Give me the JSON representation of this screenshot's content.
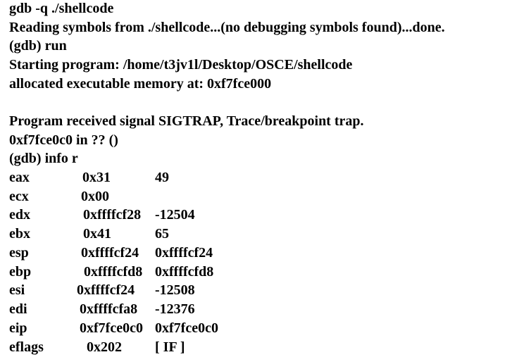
{
  "lines": [
    "gdb -q ./shellcode",
    "Reading symbols from ./shellcode...(no debugging symbols found)...done.",
    "(gdb) run",
    "Starting program: /home/t3jv1l/Desktop/OSCE/shellcode",
    "allocated executable memory at: 0xf7fce000",
    "",
    "Program received signal SIGTRAP, Trace/breakpoint trap.",
    "0xf7fce0c0 in ?? ()",
    "(gdb) info r"
  ],
  "registers": [
    {
      "name": "eax",
      "hex": "0x31",
      "value": "49"
    },
    {
      "name": "ecx",
      "hex": "0x00",
      "value": ""
    },
    {
      "name": "edx",
      "hex": "0xffffcf28",
      "value": "-12504"
    },
    {
      "name": "ebx",
      "hex": "0x41",
      "value": "65"
    },
    {
      "name": "esp",
      "hex": "0xffffcf24",
      "value": "0xffffcf24"
    },
    {
      "name": "ebp",
      "hex": "0xffffcfd8",
      "value": "0xffffcfd8"
    },
    {
      "name": "esi",
      "hex": "0xffffcf24",
      "value": "-12508"
    },
    {
      "name": "edi",
      "hex": "0xffffcfa8",
      "value": "-12376"
    },
    {
      "name": "eip",
      "hex": "0xf7fce0c0",
      "value": "0xf7fce0c0"
    },
    {
      "name": "eflags",
      "hex": "0x202",
      "value": "[ IF ]"
    }
  ]
}
